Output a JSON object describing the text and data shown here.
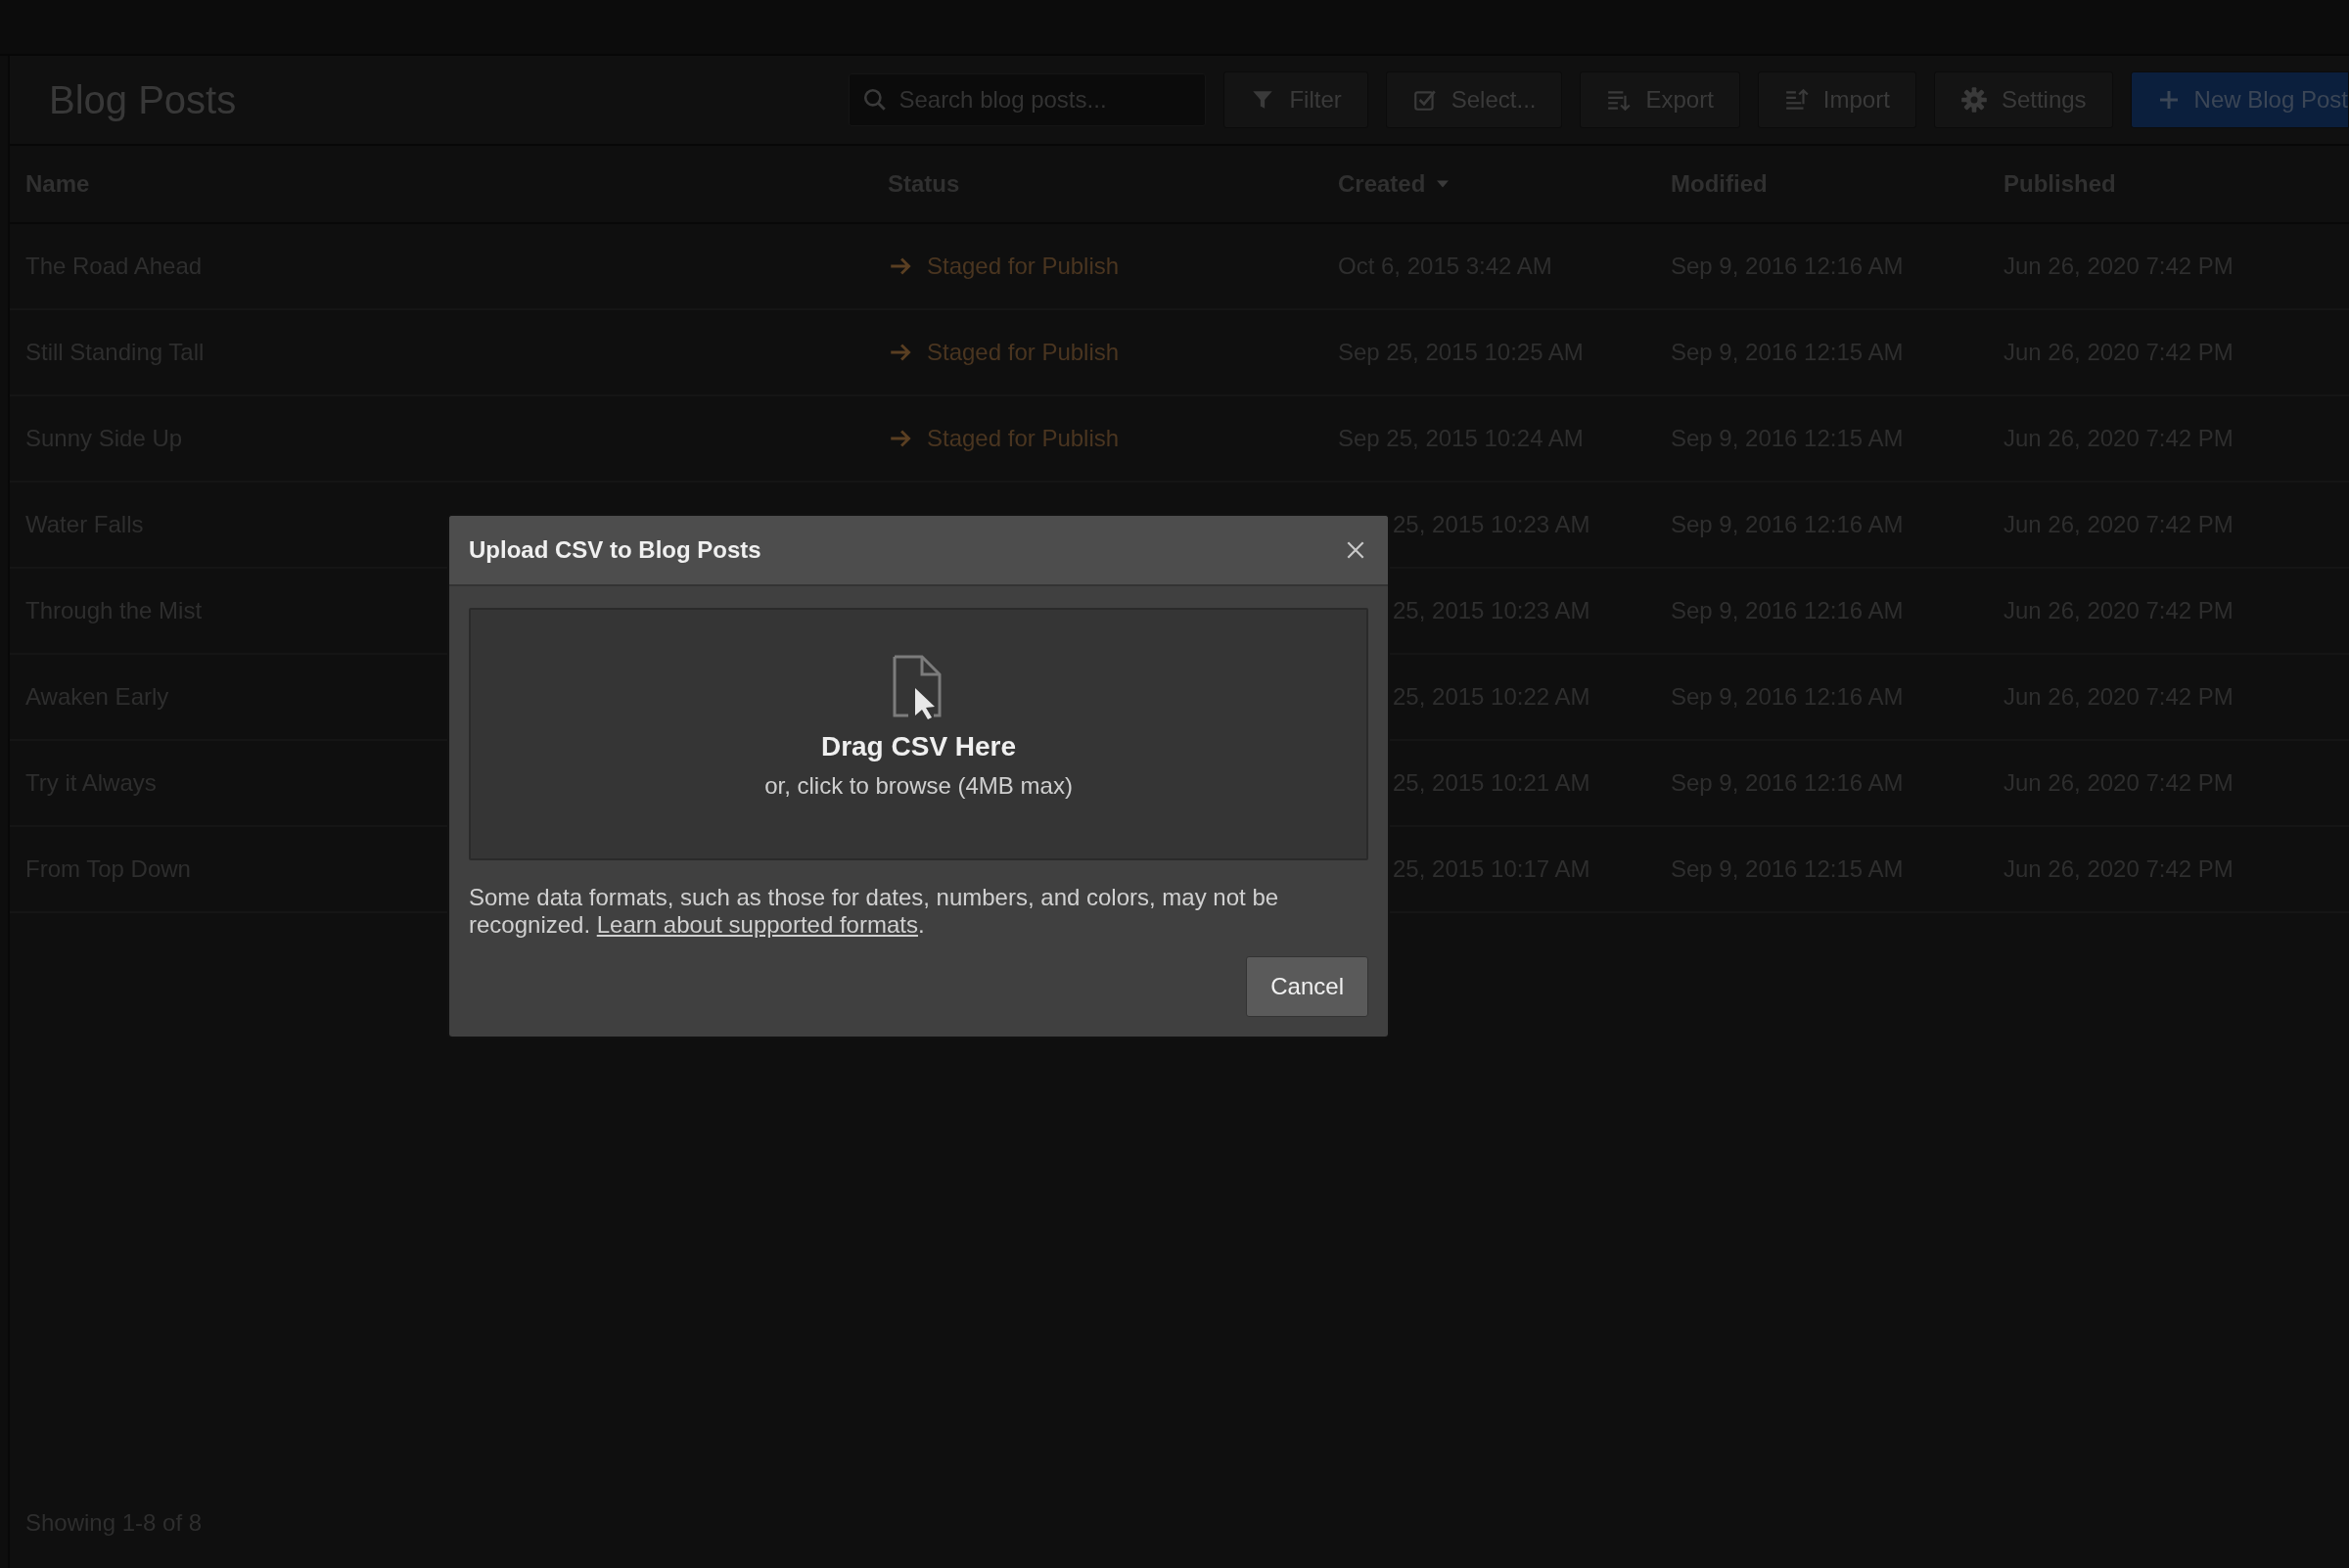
{
  "page": {
    "title": "Blog Posts"
  },
  "search": {
    "placeholder": "Search blog posts..."
  },
  "toolbar": [
    {
      "label": "Filter",
      "kind": "filter"
    },
    {
      "label": "Select...",
      "kind": "select"
    },
    {
      "label": "Export",
      "kind": "export"
    },
    {
      "label": "Import",
      "kind": "import"
    },
    {
      "label": "Settings",
      "kind": "settings"
    },
    {
      "label": "New Blog Post",
      "kind": "new"
    }
  ],
  "table": {
    "columns": [
      {
        "label": "Name",
        "sorted": false
      },
      {
        "label": "Status",
        "sorted": false
      },
      {
        "label": "Created",
        "sorted": true
      },
      {
        "label": "Modified",
        "sorted": false
      },
      {
        "label": "Published",
        "sorted": false
      }
    ],
    "rows": [
      {
        "name": "The Road Ahead",
        "status": "Staged for Publish",
        "created": "Oct 6, 2015 3:42 AM",
        "modified": "Sep 9, 2016 12:16 AM",
        "published": "Jun 26, 2020 7:42 PM"
      },
      {
        "name": "Still Standing Tall",
        "status": "Staged for Publish",
        "created": "Sep 25, 2015 10:25 AM",
        "modified": "Sep 9, 2016 12:15 AM",
        "published": "Jun 26, 2020 7:42 PM"
      },
      {
        "name": "Sunny Side Up",
        "status": "Staged for Publish",
        "created": "Sep 25, 2015 10:24 AM",
        "modified": "Sep 9, 2016 12:15 AM",
        "published": "Jun 26, 2020 7:42 PM"
      },
      {
        "name": "Water Falls",
        "created": "25, 2015 10:23 AM",
        "modified": "Sep 9, 2016 12:16 AM",
        "published": "Jun 26, 2020 7:42 PM"
      },
      {
        "name": "Through the Mist",
        "created": "25, 2015 10:23 AM",
        "modified": "Sep 9, 2016 12:16 AM",
        "published": "Jun 26, 2020 7:42 PM"
      },
      {
        "name": "Awaken Early",
        "created": "25, 2015 10:22 AM",
        "modified": "Sep 9, 2016 12:16 AM",
        "published": "Jun 26, 2020 7:42 PM"
      },
      {
        "name": "Try it Always",
        "created": "25, 2015 10:21 AM",
        "modified": "Sep 9, 2016 12:16 AM",
        "published": "Jun 26, 2020 7:42 PM"
      },
      {
        "name": "From Top Down",
        "created": "25, 2015 10:17 AM",
        "modified": "Sep 9, 2016 12:15 AM",
        "published": "Jun 26, 2020 7:42 PM"
      }
    ]
  },
  "status_bar": "Showing 1-8 of 8",
  "dialog": {
    "title": "Upload CSV to Blog Posts",
    "drop_heading": "Drag CSV Here",
    "drop_hint": "or, click to browse (4MB max)",
    "note": "Some data formats, such as those for dates, numbers, and colors, may not be recognized.",
    "link": "Learn about supported formats",
    "note_end": ".",
    "buttons": [
      "Cancel"
    ]
  }
}
